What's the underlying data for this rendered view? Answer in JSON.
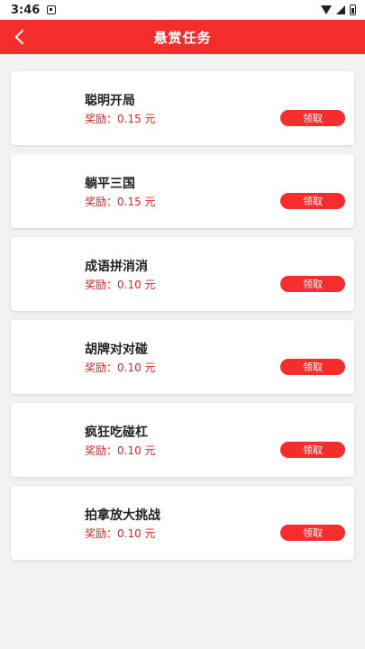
{
  "status_bar": {
    "time": "3:46"
  },
  "header": {
    "title": "悬赏任务"
  },
  "tasks": [
    {
      "name": "聪明开局",
      "reward": "奖励：0.15 元",
      "button": "领取"
    },
    {
      "name": "躺平三国",
      "reward": "奖励：0.15 元",
      "button": "领取"
    },
    {
      "name": "成语拼消消",
      "reward": "奖励：0.10 元",
      "button": "领取"
    },
    {
      "name": "胡牌对对碰",
      "reward": "奖励：0.10 元",
      "button": "领取"
    },
    {
      "name": "疯狂吃碰杠",
      "reward": "奖励：0.10 元",
      "button": "领取"
    },
    {
      "name": "拍拿放大挑战",
      "reward": "奖励：0.10 元",
      "button": "领取"
    }
  ],
  "colors": {
    "accent": "#f52d2d",
    "reward_text": "#e62020",
    "background": "#f2f2f2"
  }
}
